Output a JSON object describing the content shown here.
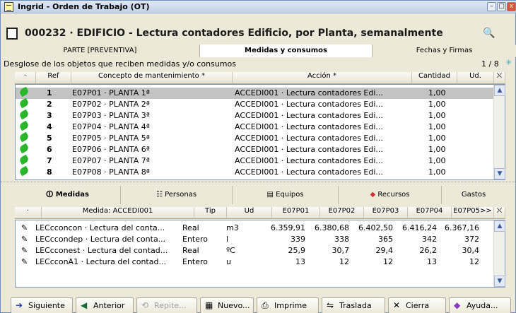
{
  "window": {
    "title": "Ingrid - Orden de Trabajo (OT)",
    "controls": [
      "–",
      "□",
      "x"
    ]
  },
  "header": {
    "title": "000232 · EDIFICIO - Lectura contadores Edificio, por Planta, semanalmente"
  },
  "tabs_top": [
    {
      "label": "PARTE [PREVENTIVA]"
    },
    {
      "label": "Medidas y consumos"
    },
    {
      "label": "Fechas y Firmas"
    }
  ],
  "section1": {
    "title": "Desglose de los objetos que reciben medidas y/o consumos",
    "pager": "1 / 8"
  },
  "list1": {
    "columns": [
      "·",
      "Ref",
      "Concepto de mantenimiento *",
      "Acción *",
      "Cantidad",
      "Ud."
    ],
    "rows": [
      {
        "num": "1",
        "concept": "E07P01 · PLANTA 1ª",
        "action": "ACCEDI001 · Lectura contadores Edi...",
        "qty": "1,00"
      },
      {
        "num": "2",
        "concept": "E07P02 · PLANTA 2ª",
        "action": "ACCEDI001 · Lectura contadores Edi...",
        "qty": "1,00"
      },
      {
        "num": "3",
        "concept": "E07P03 · PLANTA 3ª",
        "action": "ACCEDI001 · Lectura contadores Edi...",
        "qty": "1,00"
      },
      {
        "num": "4",
        "concept": "E07P04 · PLANTA 4ª",
        "action": "ACCEDI001 · Lectura contadores Edi...",
        "qty": "1,00"
      },
      {
        "num": "5",
        "concept": "E07P05 · PLANTA 5ª",
        "action": "ACCEDI001 · Lectura contadores Edi...",
        "qty": "1,00"
      },
      {
        "num": "6",
        "concept": "E07P06 · PLANTA 6ª",
        "action": "ACCEDI001 · Lectura contadores Edi...",
        "qty": "1,00"
      },
      {
        "num": "7",
        "concept": "E07P07 · PLANTA 7ª",
        "action": "ACCEDI001 · Lectura contadores Edi...",
        "qty": "1,00"
      },
      {
        "num": "8",
        "concept": "E07P08 · PLANTA 8ª",
        "action": "ACCEDI001 · Lectura contadores Edi...",
        "qty": "1,00"
      }
    ]
  },
  "tabs_bottom": [
    {
      "label": "Medidas"
    },
    {
      "label": "Personas"
    },
    {
      "label": "Equipos"
    },
    {
      "label": "Recursos"
    },
    {
      "label": "Gastos"
    }
  ],
  "list2": {
    "columns": [
      "·",
      "Medida: ACCEDI001",
      "Tip",
      "Ud",
      "E07P01",
      "E07P02",
      "E07P03",
      "E07P04",
      "E07P05>>"
    ],
    "rows": [
      {
        "medida": "LECcconcon · Lectura del conta...",
        "tip": "Real",
        "ud": "m3",
        "v": [
          "6.359,91",
          "6.380,68",
          "6.402,50",
          "6.416,24",
          "6.367,16"
        ]
      },
      {
        "medida": "LECccondep · Lectura del conta...",
        "tip": "Entero",
        "ud": "l",
        "v": [
          "339",
          "338",
          "365",
          "342",
          "372"
        ]
      },
      {
        "medida": "LECcconest · Lectura del contad...",
        "tip": "Real",
        "ud": "ºC",
        "v": [
          "25,9",
          "30,7",
          "29,4",
          "26,2",
          "30,4"
        ]
      },
      {
        "medida": "LECcconA1 · Lectura del contad...",
        "tip": "Entero",
        "ud": "u",
        "v": [
          "13",
          "12",
          "12",
          "13",
          "12"
        ]
      }
    ]
  },
  "toolbar": [
    {
      "label": "Siguiente",
      "icon": "arrow-right-icon"
    },
    {
      "label": "Anterior",
      "icon": "arrow-left-icon"
    },
    {
      "label": "Repite...",
      "icon": "repeat-icon"
    },
    {
      "label": "Nuevo...",
      "icon": "new-doc-icon"
    },
    {
      "label": "Imprime",
      "icon": "printer-icon"
    },
    {
      "label": "Traslada",
      "icon": "transfer-icon"
    },
    {
      "label": "Cierra",
      "icon": "close-icon"
    },
    {
      "label": "Ayuda...",
      "icon": "help-icon"
    }
  ],
  "colors": {
    "accent": "#316ac5",
    "selected_row": "#c3c3c3",
    "row_icon": "#2ab82a"
  }
}
